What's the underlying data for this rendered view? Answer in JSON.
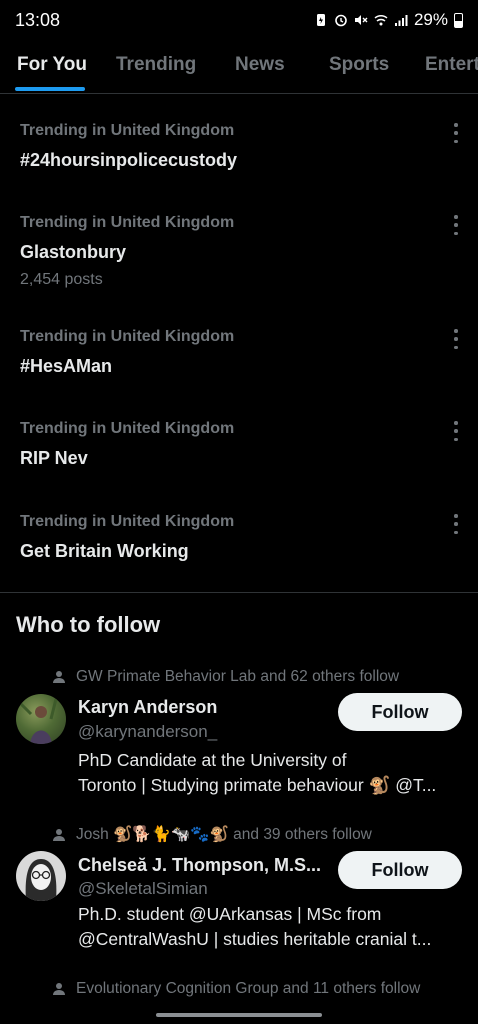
{
  "status_bar": {
    "time": "13:08",
    "battery": "29%"
  },
  "tabs": [
    {
      "label": "For You",
      "active": true
    },
    {
      "label": "Trending",
      "active": false
    },
    {
      "label": "News",
      "active": false
    },
    {
      "label": "Sports",
      "active": false
    },
    {
      "label": "Entert",
      "active": false
    }
  ],
  "trends": [
    {
      "context": "Trending in United Kingdom",
      "name": "#24hoursinpolicecustody",
      "count": ""
    },
    {
      "context": "Trending in United Kingdom",
      "name": "Glastonbury",
      "count": "2,454 posts"
    },
    {
      "context": "Trending in United Kingdom",
      "name": "#HesAMan",
      "count": ""
    },
    {
      "context": "Trending in United Kingdom",
      "name": "RIP Nev",
      "count": ""
    },
    {
      "context": "Trending in United Kingdom",
      "name": "Get Britain Working",
      "count": ""
    }
  ],
  "who_to_follow": {
    "title": "Who to follow",
    "follow_label": "Follow",
    "users": [
      {
        "social_context": "GW Primate Behavior Lab and 62 others follow",
        "name": "Karyn Anderson",
        "handle": "@karynanderson_",
        "bio_line1": "PhD Candidate at the University of",
        "bio_line2": "Toronto | Studying primate behaviour 🐒 @T..."
      },
      {
        "social_context": "Josh 🐒🐕🐈🐄🐾🐒 and 39 others follow",
        "name": "Chelseă J. Thompson, M.S...",
        "handle": "@SkeletalSimian",
        "bio_line1": "Ph.D. student @UArkansas | MSc from",
        "bio_line2": "@CentralWashU | studies heritable cranial t..."
      },
      {
        "social_context": "Evolutionary Cognition Group and 11 others follow"
      }
    ]
  },
  "colors": {
    "background": "#000000",
    "accent": "#1d9bf0",
    "secondary_text": "#71767b",
    "primary_text": "#e7e9ea"
  }
}
